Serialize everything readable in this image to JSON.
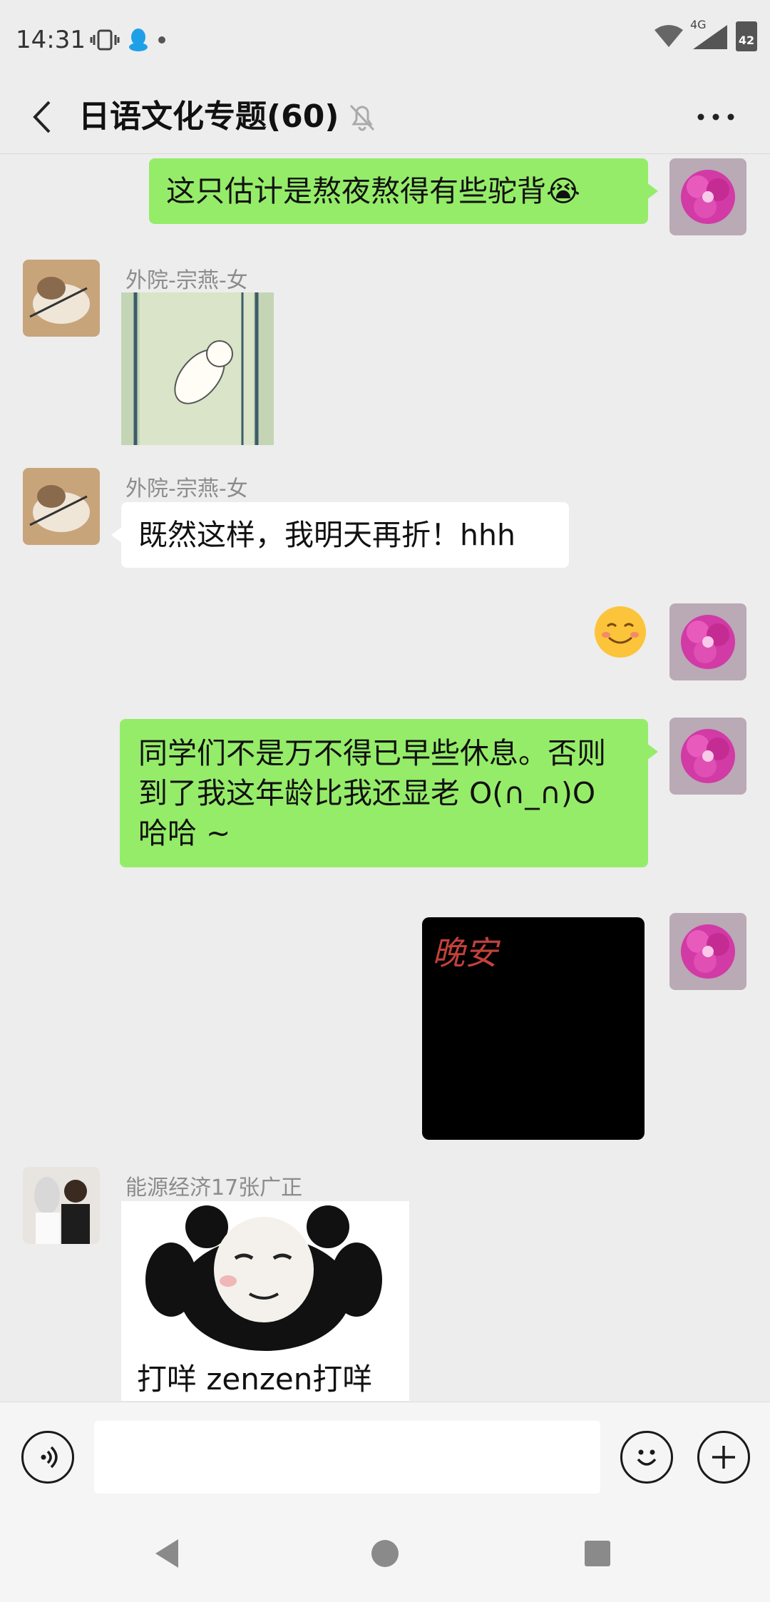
{
  "status_bar": {
    "time": "14:31",
    "network": "4G",
    "battery": "42"
  },
  "header": {
    "title": "日语文化专题(60)"
  },
  "messages": [
    {
      "side": "right",
      "type": "text",
      "text": "这只估计是熬夜熬得有些驼背😭"
    },
    {
      "side": "left",
      "type": "sticker",
      "sender": "外院-宗燕-女"
    },
    {
      "side": "left",
      "type": "text",
      "sender": "外院-宗燕-女",
      "text": "既然这样，我明天再折！hhh"
    },
    {
      "side": "right",
      "type": "emoji",
      "text": "☺️"
    },
    {
      "side": "right",
      "type": "text",
      "text": "同学们不是万不得已早些休息。否则到了我这年龄比我还显老 O(∩_∩)O 哈哈 ~"
    },
    {
      "side": "right",
      "type": "sticker",
      "text": "晚安"
    },
    {
      "side": "left",
      "type": "sticker",
      "sender": "能源经济17张广正",
      "text": "打咩 zenzen打咩"
    }
  ],
  "input": {
    "value": "",
    "placeholder": ""
  },
  "colors": {
    "background": "#ededed",
    "self_bubble": "#95ec69",
    "other_bubble": "#ffffff"
  },
  "icons": {
    "voice": "voice-icon",
    "emoji": "emoji-icon",
    "plus": "plus-icon",
    "back": "back-arrow-icon",
    "mute": "mute-bell-icon",
    "more": "more-icon"
  }
}
